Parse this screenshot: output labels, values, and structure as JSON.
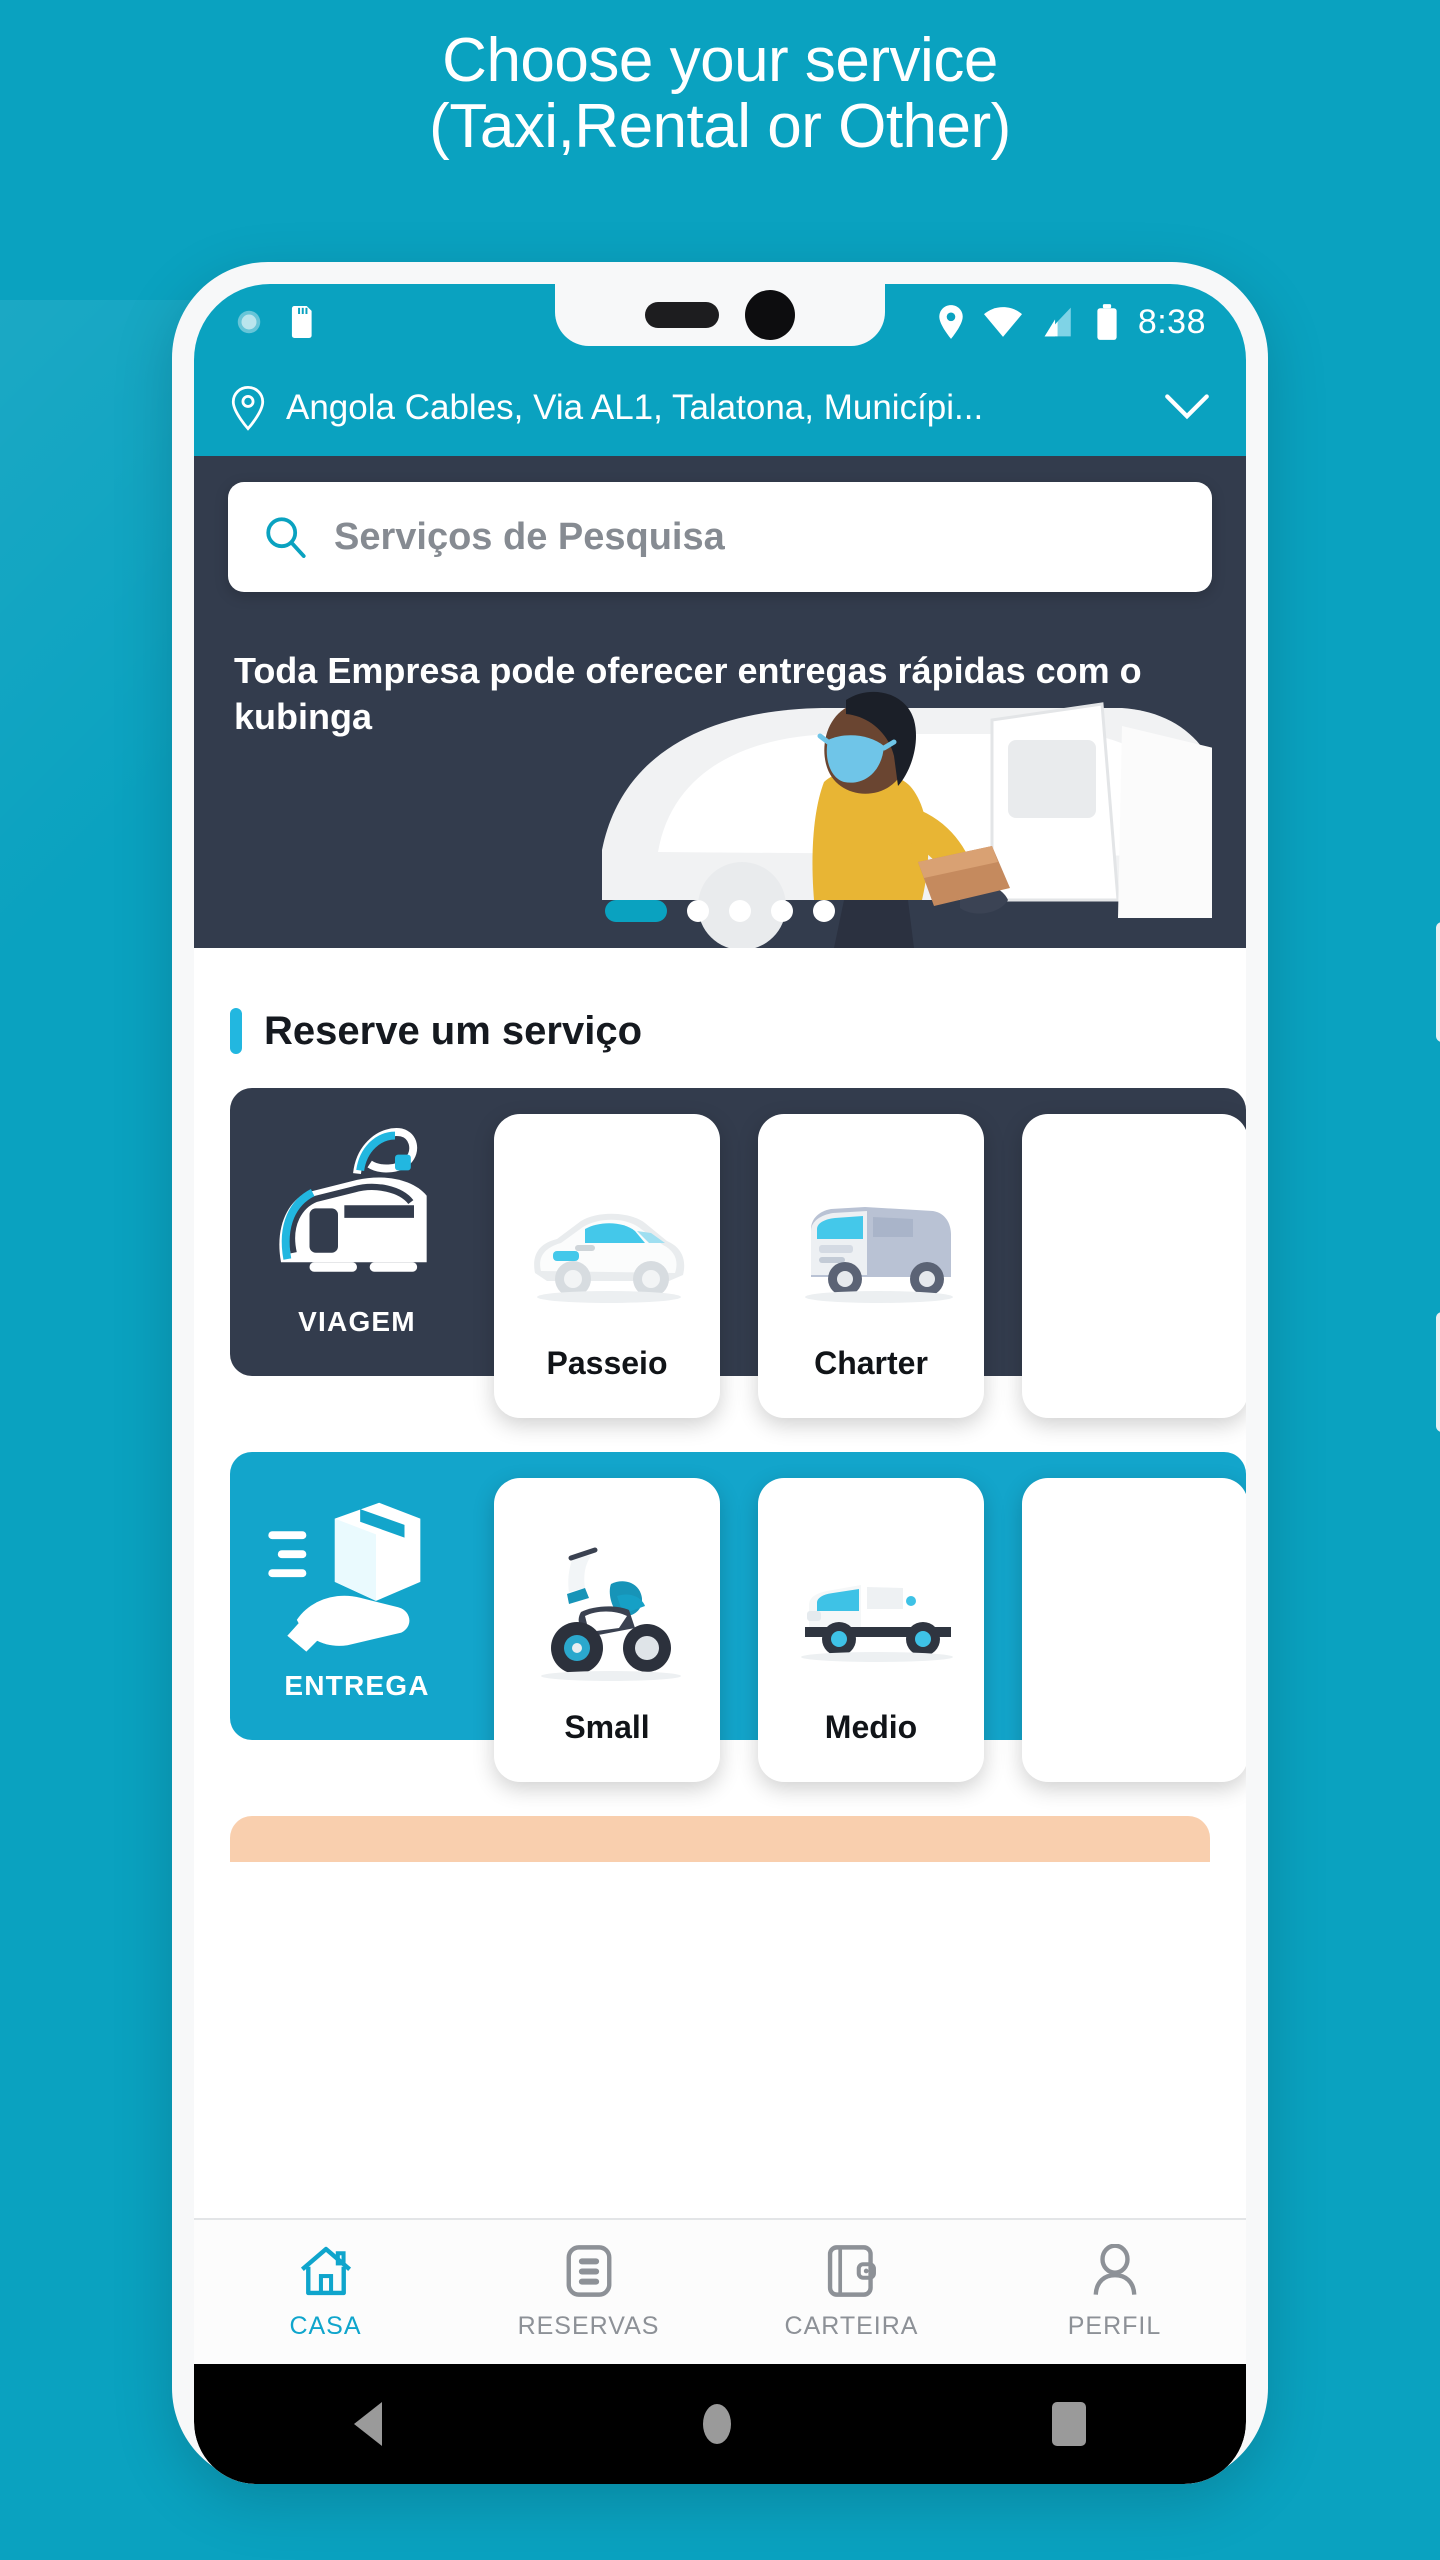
{
  "promo_header": {
    "line1": "Choose your service",
    "line2": "(Taxi,Rental or Other)"
  },
  "statusbar": {
    "time": "8:38",
    "icons_left": [
      "sync-icon",
      "sd-card-icon"
    ],
    "icons_right": [
      "location-pin-icon",
      "wifi-icon",
      "signal-icon",
      "battery-icon"
    ]
  },
  "location": {
    "address": "Angola Cables, Via AL1, Talatona, Municípi...",
    "pin_icon": "location-pin-icon",
    "chevron": "chevron-down-icon"
  },
  "search": {
    "placeholder": "Serviços de Pesquisa",
    "icon": "search-icon"
  },
  "banner": {
    "text": "Toda Empresa pode oferecer entregas rápidas com o kubinga",
    "dots_total": 5,
    "dots_active_index": 0
  },
  "section": {
    "title": "Reserve um serviço"
  },
  "service_rows": [
    {
      "brand": "VIAGEM",
      "brand_icon": "taxi-icon",
      "color": "#333c4d",
      "cards": [
        {
          "label": "Passeio",
          "icon": "small-car-icon"
        },
        {
          "label": "Charter",
          "icon": "minibus-icon"
        },
        {
          "label": "",
          "icon": "partial-card-icon"
        }
      ]
    },
    {
      "brand": "ENTREGA",
      "brand_icon": "package-hand-icon",
      "color": "#13a5cb",
      "cards": [
        {
          "label": "Small",
          "icon": "scooter-icon"
        },
        {
          "label": "Medio",
          "icon": "delivery-van-icon"
        },
        {
          "label": "",
          "icon": "partial-card-icon"
        }
      ]
    }
  ],
  "bottom_nav": [
    {
      "label": "CASA",
      "icon": "home-icon",
      "active": true
    },
    {
      "label": "RESERVAS",
      "icon": "list-icon",
      "active": false
    },
    {
      "label": "CARTEIRA",
      "icon": "wallet-icon",
      "active": false
    },
    {
      "label": "PERFIL",
      "icon": "person-icon",
      "active": false
    }
  ],
  "android_nav": [
    "back-icon",
    "home-circle-icon",
    "recents-icon"
  ],
  "colors": {
    "brand_teal": "#0aa2c0",
    "accent_teal": "#22b7e0",
    "dark_navy": "#333c4d",
    "peach": "#f9cfae"
  }
}
